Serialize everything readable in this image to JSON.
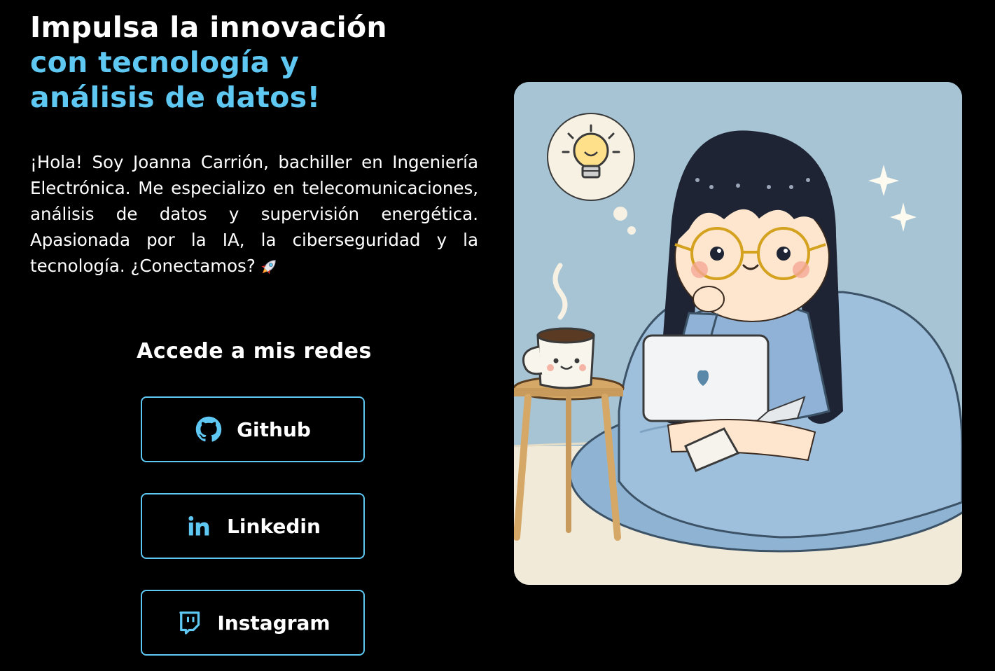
{
  "hero": {
    "line1": "Impulsa la innovación",
    "line2": "con tecnología y",
    "line3": "análisis de datos!"
  },
  "bio": {
    "text": "¡Hola! Soy Joanna Carrión, bachiller en Ingeniería Electrónica. Me especializo en telecomunicaciones, análisis de datos y supervisión energética. Apasionada por la IA, la ciberseguridad y la tecnología. ¿Conectamos?",
    "emoji_icon": "rocket-icon"
  },
  "networks": {
    "title": "Accede a mis redes",
    "buttons": [
      {
        "label": "Github",
        "icon": "github-icon"
      },
      {
        "label": "Linkedin",
        "icon": "linkedin-icon"
      },
      {
        "label": "Instagram",
        "icon": "twitch-icon"
      }
    ]
  },
  "colors": {
    "background": "#000000",
    "accent": "#5ec8f2",
    "text": "#ffffff"
  }
}
